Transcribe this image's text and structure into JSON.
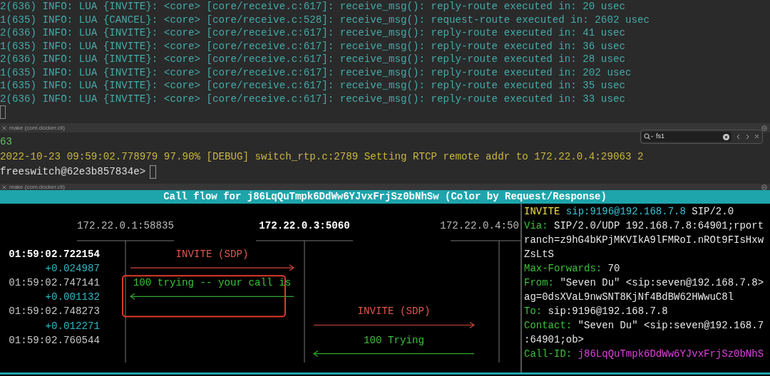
{
  "top_pane": {
    "log_lines": [
      "2(636) INFO: LUA {INVITE}: <core> [core/receive.c:617]: receive_msg(): reply-route executed in: 20 usec",
      "1(635) INFO: LUA {CANCEL}: <core> [core/receive.c:528]: receive_msg(): request-route executed in: 2602 usec",
      "2(636) INFO: LUA {INVITE}: <core> [core/receive.c:617]: receive_msg(): reply-route executed in: 41 usec",
      "1(635) INFO: LUA {INVITE}: <core> [core/receive.c:617]: receive_msg(): reply-route executed in: 36 usec",
      "2(636) INFO: LUA {INVITE}: <core> [core/receive.c:617]: receive_msg(): reply-route executed in: 28 usec",
      "1(635) INFO: LUA {INVITE}: <core> [core/receive.c:617]: receive_msg(): reply-route executed in: 202 usec",
      "1(635) INFO: LUA {INVITE}: <core> [core/receive.c:617]: receive_msg(): reply-route executed in: 35 usec",
      "2(636) INFO: LUA {INVITE}: <core> [core/receive.c:617]: receive_msg(): reply-route executed in: 33 usec"
    ]
  },
  "tabs": [
    {
      "title": "make (com.docker.cli)"
    },
    {
      "title": "make (com.docker.cli)"
    }
  ],
  "find_bar": {
    "value": "fs1"
  },
  "middle_pane": {
    "lines": [
      {
        "kind": "counter",
        "text": "63"
      },
      {
        "kind": "debug",
        "text": "2022-10-23 09:59:02.778979 97.90% [DEBUG] switch_rtp.c:2789 Setting RTCP remote addr to 172.22.0.4:29063 2"
      },
      {
        "kind": "prompt",
        "text": "freeswitch@62e3b857834e>"
      }
    ]
  },
  "call_flow": {
    "title": "Call flow for j86LqQuTmpk6DdWw6YJvxFrjSz0bNhSw (Color by Request/Response)",
    "hosts": [
      {
        "label": "172.22.0.1:58835",
        "selected": false
      },
      {
        "label": "172.22.0.3:5060",
        "selected": true
      },
      {
        "label": "172.22.0.4:50",
        "selected": false
      }
    ],
    "timestamps": [
      {
        "kind": "time",
        "text": "01:59:02.722154",
        "selected": true
      },
      {
        "kind": "delta",
        "text": "+0.024987",
        "selected": false
      },
      {
        "kind": "time",
        "text": "01:59:02.747141",
        "selected": false
      },
      {
        "kind": "delta",
        "text": "+0.001132",
        "selected": false
      },
      {
        "kind": "time",
        "text": "01:59:02.748273",
        "selected": false
      },
      {
        "kind": "delta",
        "text": "+0.012271",
        "selected": false
      },
      {
        "kind": "time",
        "text": "01:59:02.760544",
        "selected": false
      }
    ],
    "lane_pairs": [
      {
        "messages": [
          {
            "kind": "request",
            "label": "INVITE (SDP)",
            "highlighted": false
          },
          {
            "kind": "response",
            "label": "100 trying -- your call is",
            "highlighted": true
          }
        ]
      },
      {
        "messages": [
          {
            "kind": "request",
            "label": "INVITE (SDP)",
            "highlighted": false
          },
          {
            "kind": "response",
            "label": "100 Trying",
            "highlighted": false
          }
        ]
      }
    ]
  },
  "sip_message": {
    "lines": [
      [
        {
          "kind": "method",
          "text": "INVITE"
        },
        {
          "kind": "uri",
          "text": " sip:9196@192.168.7.8"
        },
        {
          "kind": "value",
          "text": " SIP/2.0"
        }
      ],
      [
        {
          "kind": "header",
          "text": "Via:"
        },
        {
          "kind": "value",
          "text": " SIP/2.0/UDP 192.168.7.8:64901;rport"
        }
      ],
      [
        {
          "kind": "value",
          "text": "ranch=z9hG4bKPjMKVIkA9lFMRoI.nROt9FIsHxw"
        }
      ],
      [
        {
          "kind": "value",
          "text": "ZsLtS"
        }
      ],
      [
        {
          "kind": "header",
          "text": "Max-Forwards:"
        },
        {
          "kind": "value",
          "text": " 70"
        }
      ],
      [
        {
          "kind": "header",
          "text": "From:"
        },
        {
          "kind": "value",
          "text": " \"Seven Du\" <sip:seven@192.168.7.8>"
        }
      ],
      [
        {
          "kind": "value",
          "text": "ag=0dsXVaL9nwSNT8KjNf4BdBW62HWwuC8l"
        }
      ],
      [
        {
          "kind": "header",
          "text": "To:"
        },
        {
          "kind": "value",
          "text": " sip:9196@192.168.7.8"
        }
      ],
      [
        {
          "kind": "header",
          "text": "Contact:"
        },
        {
          "kind": "value",
          "text": " \"Seven Du\" <sip:seven@192.168.7"
        }
      ],
      [
        {
          "kind": "value",
          "text": ":64901;ob>"
        }
      ],
      [
        {
          "kind": "header",
          "text": "Call-ID:"
        },
        {
          "kind": "callid",
          "text": " j86LqQuTmpk6DdWw6YJvxFrjSz0bNhS"
        }
      ]
    ]
  }
}
